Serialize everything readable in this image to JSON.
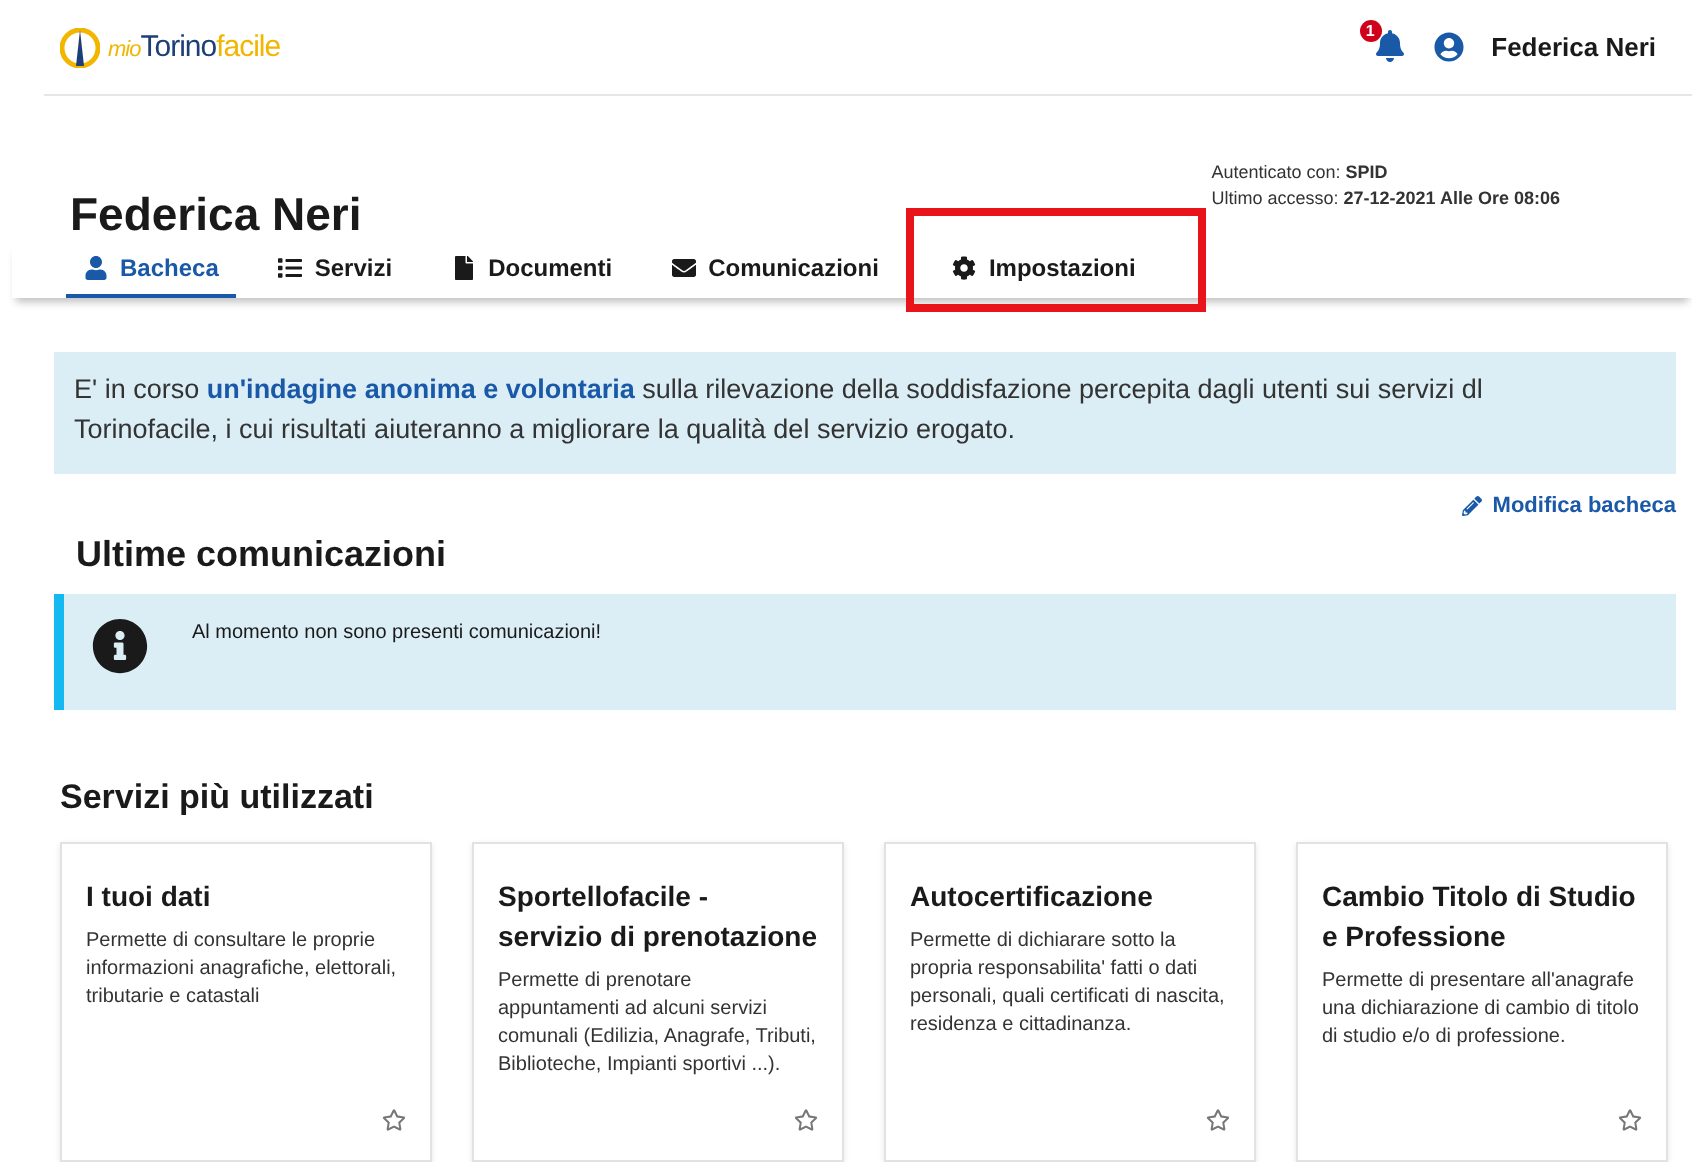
{
  "header": {
    "logo_prefix": "mio",
    "logo_main": "Torino",
    "logo_suffix": "facile",
    "notification_count": "1",
    "user_name": "Federica Neri"
  },
  "profile": {
    "name": "Federica Neri",
    "auth_label": "Autenticato con:",
    "auth_value": "SPID",
    "access_label": "Ultimo accesso:",
    "access_value": "27-12-2021 Alle Ore 08:06"
  },
  "tabs": [
    {
      "label": "Bacheca",
      "kind": "user",
      "selected": true,
      "highlighted": false
    },
    {
      "label": "Servizi",
      "kind": "list",
      "selected": false,
      "highlighted": false
    },
    {
      "label": "Documenti",
      "kind": "file",
      "selected": false,
      "highlighted": false
    },
    {
      "label": "Comunicazioni",
      "kind": "mail",
      "selected": false,
      "highlighted": false
    },
    {
      "label": "Impostazioni",
      "kind": "gear",
      "selected": false,
      "highlighted": true
    }
  ],
  "notice": {
    "before": "E' in corso ",
    "link": "un'indagine anonima e volontaria",
    "after": " sulla rilevazione della soddisfazione percepita dagli utenti sui servizi dl Torinofacile, i cui risultati aiuteranno a migliorare la qualità del servizio erogato."
  },
  "edit_link": "Modifica bacheca",
  "communications": {
    "title": "Ultime comunicazioni",
    "message": "Al momento non sono presenti comunicazioni!"
  },
  "services": {
    "title": "Servizi più utilizzati",
    "cards": [
      {
        "title": "I tuoi dati",
        "description": "Permette di consultare le proprie informazioni anagrafiche, elettorali, tributarie e catastali",
        "favorite": false
      },
      {
        "title": "Sportellofacile - servizio di prenotazione",
        "description": "Permette di prenotare appuntamenti ad alcuni servizi comunali (Edilizia, Anagrafe, Tributi, Biblioteche, Impianti sportivi ...).",
        "favorite": false
      },
      {
        "title": "Autocertificazione",
        "description": "Permette di dichiarare sotto la propria responsabilita' fatti o dati personali, quali certificati di nascita, residenza e cittadinanza.",
        "favorite": false
      },
      {
        "title": "Cambio Titolo di Studio e Professione",
        "description": "Permette di presentare all'anagrafe una dichiarazione di cambio di titolo di studio e/o di professione.",
        "favorite": false
      }
    ]
  }
}
